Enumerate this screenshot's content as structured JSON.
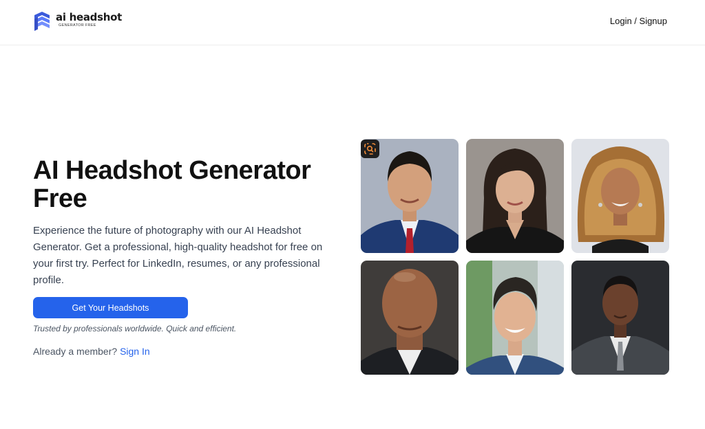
{
  "header": {
    "logo_name": "ai headshot",
    "logo_tagline": "GENERATOR FREE",
    "login_label": "Login / Signup"
  },
  "hero": {
    "title": "AI Headshot Generator Free",
    "description": "Experience the future of photography with our AI Headshot Generator. Get a professional, high-quality headshot for free on your first try. Perfect for LinkedIn, resumes, or any professional profile.",
    "cta_label": "Get Your Headshots",
    "trusted_text": "Trusted by professionals worldwide. Quick and efficient.",
    "member_prompt": "Already a member?",
    "sign_in_label": "Sign In"
  },
  "colors": {
    "accent": "#2563eb",
    "text_muted": "#4b5563"
  },
  "gallery": {
    "icons": [
      "lens-search-icon"
    ],
    "headshots": [
      {
        "name": "headshot-man-navy-suit-red-tie"
      },
      {
        "name": "headshot-woman-dark-hair-black-blazer"
      },
      {
        "name": "headshot-woman-wavy-blonde-hair"
      },
      {
        "name": "headshot-bald-man-dark-suit"
      },
      {
        "name": "headshot-young-man-blue-suit"
      },
      {
        "name": "headshot-man-grey-suit"
      }
    ]
  }
}
